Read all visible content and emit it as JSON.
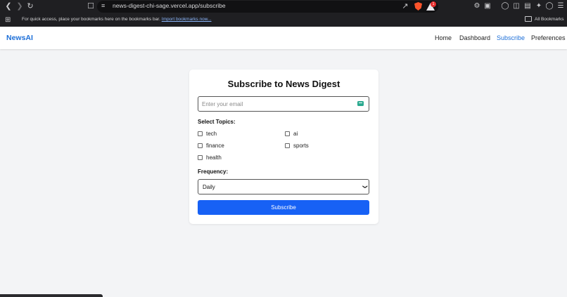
{
  "browser": {
    "url": "news-digest-chi-sage.vercel.app/subscribe",
    "bookmarks_prompt": "For quick access, place your bookmarks here on the bookmarks bar.",
    "import_link": "Import bookmarks now...",
    "all_bookmarks": "All Bookmarks",
    "rewards_count": "1"
  },
  "header": {
    "logo": "NewsAI",
    "nav": {
      "home": "Home",
      "dashboard": "Dashboard",
      "subscribe": "Subscribe",
      "preferences": "Preferences"
    },
    "active": "Subscribe"
  },
  "form": {
    "title": "Subscribe to News Digest",
    "email_placeholder": "Enter your email",
    "email_value": "",
    "topics_label": "Select Topics:",
    "topics": [
      "tech",
      "ai",
      "finance",
      "sports",
      "health"
    ],
    "frequency_label": "Frequency:",
    "frequency_value": "Daily",
    "submit_label": "Subscribe"
  },
  "colors": {
    "brand": "#1d6fd8",
    "button": "#1761f5",
    "background": "#f3f4f6"
  }
}
